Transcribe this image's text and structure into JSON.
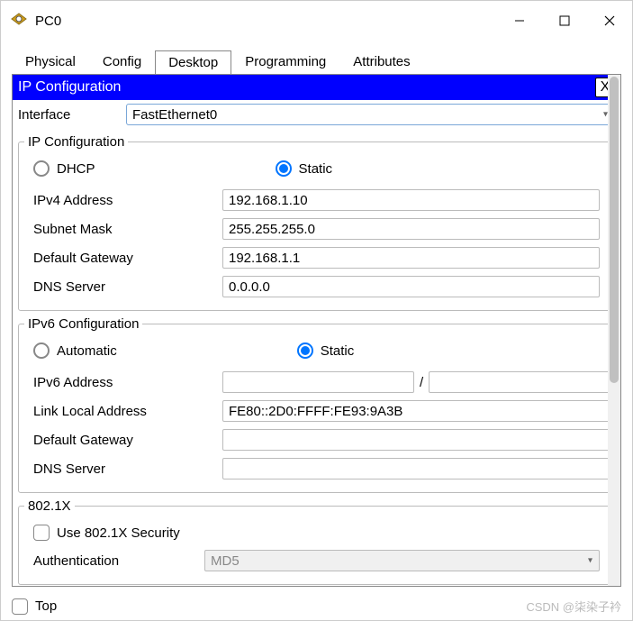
{
  "window": {
    "title": "PC0"
  },
  "tabs": [
    "Physical",
    "Config",
    "Desktop",
    "Programming",
    "Attributes"
  ],
  "active_tab": "Desktop",
  "panel": {
    "header": "IP Configuration",
    "close": "X",
    "interface_label": "Interface",
    "interface_value": "FastEthernet0"
  },
  "ipv4": {
    "legend": "IP Configuration",
    "dhcp_label": "DHCP",
    "static_label": "Static",
    "mode": "Static",
    "fields": {
      "ipv4_label": "IPv4 Address",
      "ipv4_value": "192.168.1.10",
      "mask_label": "Subnet Mask",
      "mask_value": "255.255.255.0",
      "gw_label": "Default Gateway",
      "gw_value": "192.168.1.1",
      "dns_label": "DNS Server",
      "dns_value": "0.0.0.0"
    }
  },
  "ipv6": {
    "legend": "IPv6 Configuration",
    "auto_label": "Automatic",
    "static_label": "Static",
    "mode": "Static",
    "fields": {
      "addr_label": "IPv6 Address",
      "addr_value": "",
      "prefix_sep": "/",
      "prefix_value": "",
      "ll_label": "Link Local Address",
      "ll_value": "FE80::2D0:FFFF:FE93:9A3B",
      "gw_label": "Default Gateway",
      "gw_value": "",
      "dns_label": "DNS Server",
      "dns_value": ""
    }
  },
  "dot1x": {
    "legend": "802.1X",
    "chk_label": "Use 802.1X Security",
    "checked": false,
    "auth_label": "Authentication",
    "auth_value": "MD5"
  },
  "footer": {
    "top_label": "Top",
    "top_checked": false,
    "watermark": "CSDN @柒染子衿"
  }
}
